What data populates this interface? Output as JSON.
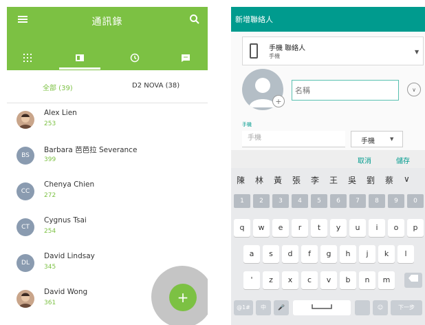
{
  "left": {
    "title": "通訊錄",
    "tabs": [
      {
        "icon": "dialpad-icon"
      },
      {
        "icon": "contacts-card-icon",
        "active": true
      },
      {
        "icon": "clock-icon"
      },
      {
        "icon": "message-icon"
      }
    ],
    "filters": {
      "all": "全部 (39)",
      "nova": "D2 NOVA (38)"
    },
    "contacts": [
      {
        "name": "Alex Lien",
        "count": "253",
        "avatar": "photo",
        "initials": ""
      },
      {
        "name": "Barbara 芭芭拉 Severance",
        "count": "399",
        "avatar": "initials",
        "initials": "BS"
      },
      {
        "name": "Chenya Chien",
        "count": "272",
        "avatar": "initials",
        "initials": "CC"
      },
      {
        "name": "Cygnus Tsai",
        "count": "254",
        "avatar": "initials",
        "initials": "CT"
      },
      {
        "name": "David Lindsay",
        "count": "345",
        "avatar": "initials",
        "initials": "DL"
      },
      {
        "name": "David Wong",
        "count": "361",
        "avatar": "photo",
        "initials": ""
      }
    ],
    "fab_label": "+"
  },
  "right": {
    "title": "新增聯絡人",
    "account": {
      "main": "手機 聯絡人",
      "sub": "手機"
    },
    "name_placeholder": "名稱",
    "phone_section_label": "手機",
    "phone_placeholder": "手機",
    "phone_type": "手機",
    "cancel_label": "取消",
    "save_label": "儲存",
    "candidates": [
      "陳",
      "林",
      "黃",
      "張",
      "李",
      "王",
      "吳",
      "劉",
      "蔡",
      "∨"
    ],
    "number_keys": [
      "1",
      "2",
      "3",
      "4",
      "5",
      "6",
      "7",
      "8",
      "9",
      "0"
    ],
    "row1": [
      "q",
      "w",
      "e",
      "r",
      "t",
      "y",
      "u",
      "i",
      "o",
      "p"
    ],
    "row2": [
      "a",
      "s",
      "d",
      "f",
      "g",
      "h",
      "j",
      "k",
      "l"
    ],
    "row3": [
      "'",
      "z",
      "x",
      "c",
      "v",
      "b",
      "n",
      "m"
    ],
    "bottom": {
      "symbols": "@1#",
      "lang": "中",
      "mic": "🎤",
      "emoji": "☺",
      "next": "下一步"
    }
  },
  "colors": {
    "green": "#7cc143",
    "teal": "#009b8e",
    "avatar_gray": "#8a9bb0"
  }
}
